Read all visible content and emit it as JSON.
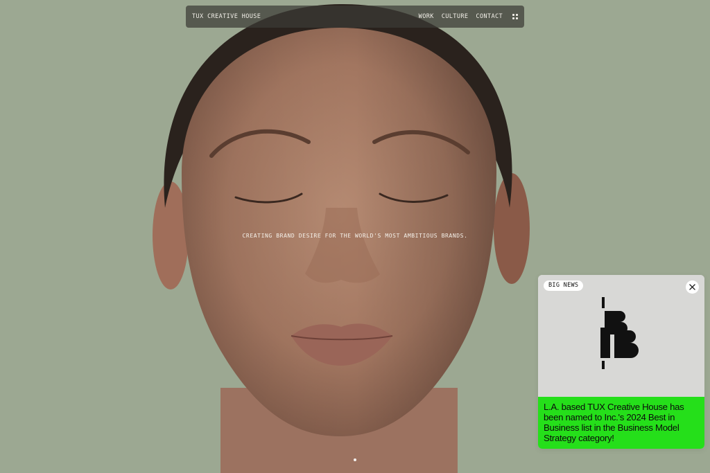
{
  "nav": {
    "brand": "TUX CREATIVE HOUSE",
    "links": [
      "WORK",
      "CULTURE",
      "CONTACT"
    ],
    "menu_icon": "grid-dots-icon"
  },
  "hero": {
    "tagline": "CREATING BRAND DESIRE FOR THE WORLD'S MOST AMBITIOUS BRANDS."
  },
  "news": {
    "badge": "BIG NEWS",
    "close_icon": "close-icon",
    "text": "L.A. based TUX Creative House has been named to Inc.'s 2024 Best in Business list in the Business Model Strategy category!",
    "accent_color": "#25df1a"
  },
  "colors": {
    "background": "#9ca892",
    "nav_bg": "#3c3a34"
  }
}
